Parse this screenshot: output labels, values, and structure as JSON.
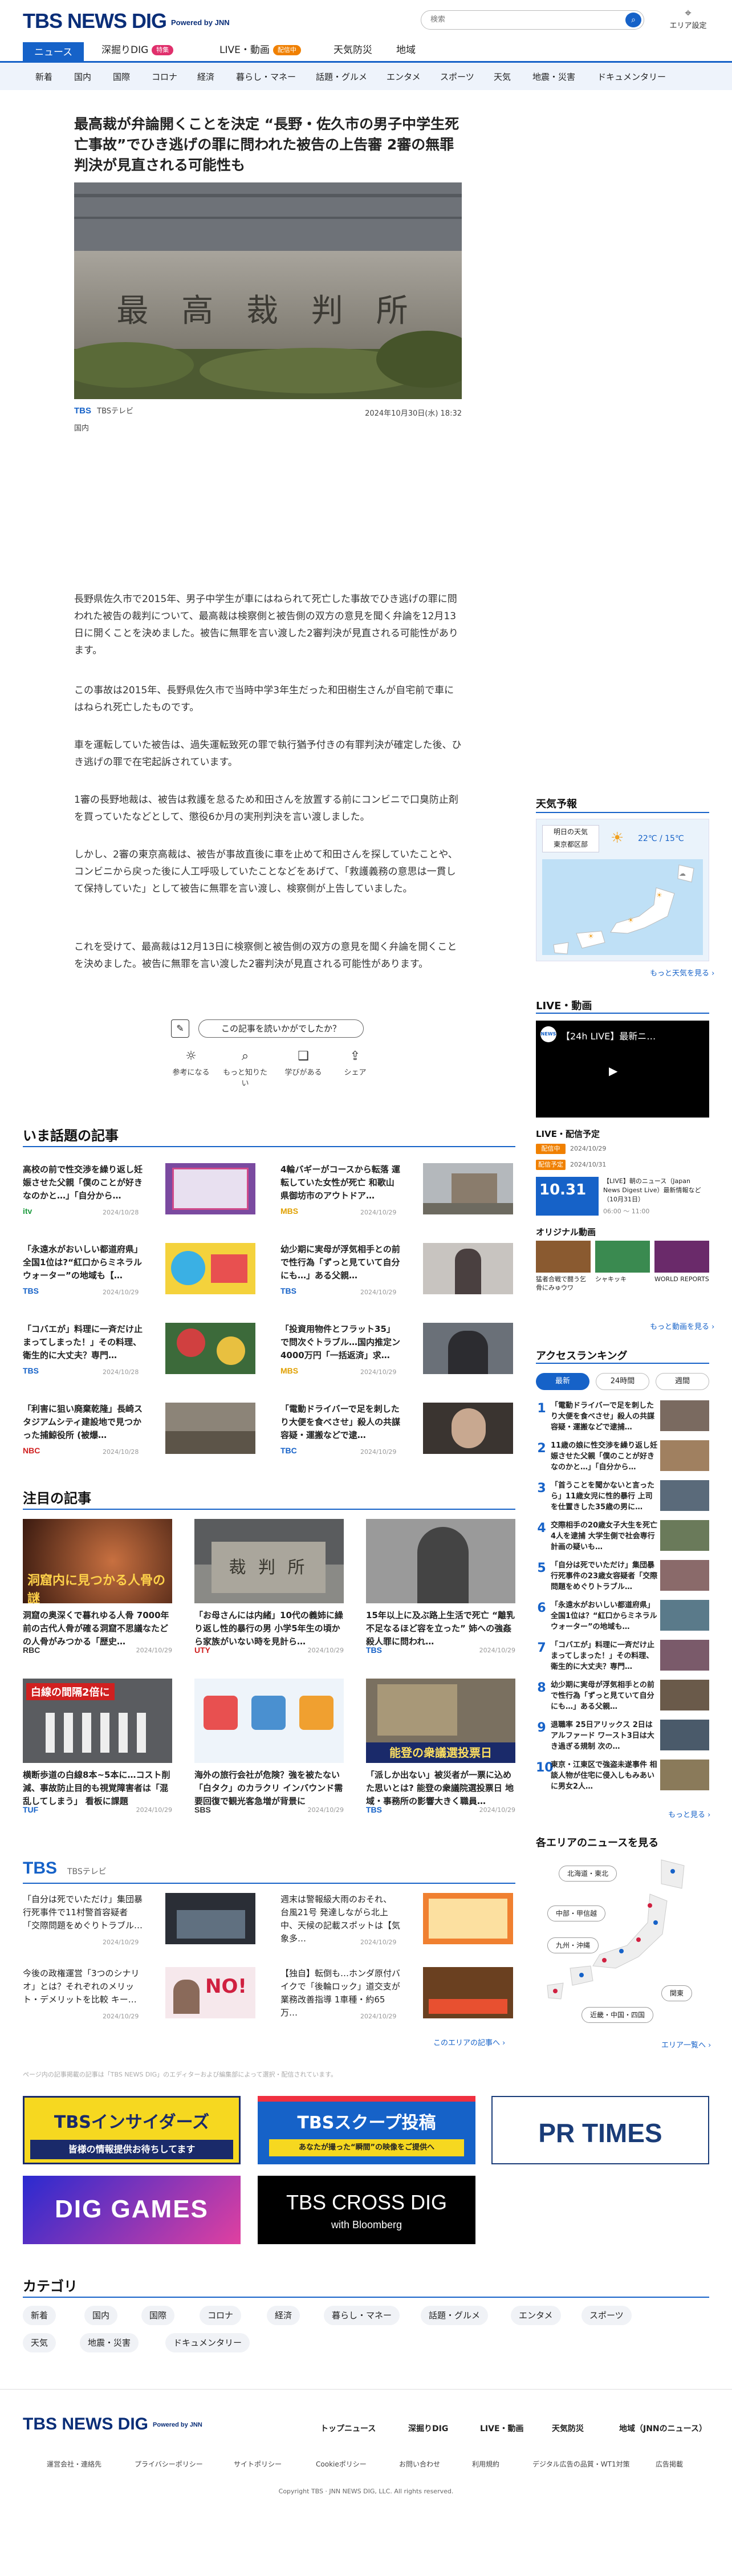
{
  "header": {
    "logo": "TBS NEWS DIG",
    "powered": "Powered by JNN",
    "search_placeholder": "検索",
    "area_label": "エリア設定"
  },
  "nav_main": [
    {
      "label": "ニュース",
      "active": true
    },
    {
      "label": "深掘りDIG",
      "badge": "特集"
    },
    {
      "label": "LIVE・動画",
      "badge": "配信中"
    },
    {
      "label": "天気防災"
    },
    {
      "label": "地域"
    }
  ],
  "nav_sub": [
    "新着",
    "国内",
    "国際",
    "コロナ",
    "経済",
    "暮らし・マネー",
    "話題・グルメ",
    "エンタメ",
    "スポーツ",
    "天気",
    "地震・災害",
    "ドキュメンタリー"
  ],
  "article": {
    "title": "最高裁が弁論開くことを決定 “長野・佐久市の男子中学生死亡事故”でひき逃げの罪に問われた被告の上告審 2審の無罪判決が見直される可能性も",
    "image_text": "最 高 裁 判 所",
    "source": "TBS",
    "source_name": "TBSテレビ",
    "date": "2024年10月30日(水) 18:32",
    "category": "国内",
    "paragraphs": [
      "長野県佐久市で2015年、男子中学生が車にはねられて死亡した事故でひき逃げの罪に問われた被告の裁判について、最高裁は検察側と被告側の双方の意見を聞く弁論を12月13日に開くことを決めました。被告に無罪を言い渡した2審判決が見直される可能性があります。",
      "この事故は2015年、長野県佐久市で当時中学3年生だった和田樹生さんが自宅前で車にはねられ死亡したものです。",
      "車を運転していた被告は、過失運転致死の罪で執行猶予付きの有罪判決が確定した後、ひき逃げの罪で在宅起訴されています。",
      "1審の長野地裁は、被告は救護を怠るため和田さんを放置する前にコンビニで口臭防止剤を買っていたなどとして、懲役6か月の実刑判決を言い渡しました。",
      "しかし、2審の東京高裁は、被告が事故直後に車を止めて和田さんを探していたことや、コンビニから戻った後に人工呼吸していたことなどをあげて、「救護義務の意思は一貫して保持していた」として被告に無罪を言い渡し、検察側が上告していました。",
      "これを受けて、最高裁は12月13日に検察側と被告側の双方の意見を聞く弁論を開くことを決めました。被告に無罪を言い渡した2審判決が見直される可能性があります。"
    ],
    "survey_question": "この記事を読いかがでしたか？",
    "reactions": [
      "参考になる",
      "もっと知りたい",
      "学びがある",
      "シェア"
    ]
  },
  "trending": {
    "heading": "いま話題の記事",
    "items": [
      {
        "title": "高校の前で性交渉を繰り返し妊娠させた父親「僕のことが好きなのかと…」「自分から…",
        "source": "itv",
        "source_color": "#1a9a3c",
        "date": "2024/10/28"
      },
      {
        "title": "4輪バギーがコースから転落 運転していた女性が死亡 和歌山県御坊市のアウトドア…",
        "source": "MBS",
        "source_color": "#e0a000",
        "date": "2024/10/29"
      },
      {
        "title": "「永遠水がおいしい都道府県」全国1位は?“紅口からミネラルウォーター”の地域も【…",
        "source": "TBS",
        "source_color": "#1662c8",
        "date": "2024/10/29"
      },
      {
        "title": "幼少期に実母が浮気相手との前で性行為「ずっと見ていて自分にも…」ある父親…",
        "source": "TBS",
        "source_color": "#1662c8",
        "date": "2024/10/29"
      },
      {
        "title": "「コバエが」料理に一斉だけ止まってしまった！」その料理、衛生的に大丈夫？専門…",
        "source": "TBS",
        "source_color": "#1662c8",
        "date": "2024/10/28"
      },
      {
        "title": "「投資用物件とフラット35」で問次ぐトラブル…国内推定ン4000万円「一括返済」求…",
        "source": "MBS",
        "source_color": "#e0a000",
        "date": "2024/10/29"
      },
      {
        "title": "「利害に狙い廃棄乾隆」長崎スタジアムシティ建設地で見つかった捕鯨役所 (被爆…",
        "source": "NBC",
        "source_color": "#d02020",
        "date": "2024/10/28"
      },
      {
        "title": "「電動ドライバーで足を刺したり大便を食べさせ」殺人の共謀容疑・運搬などで逮…",
        "source": "TBC",
        "source_color": "#1662c8",
        "date": "2024/10/29"
      }
    ]
  },
  "featured": {
    "heading": "注目の記事",
    "items": [
      {
        "title": "洞窟の奥深くで暮れゆる人骨 7000年前の古代人骨が確る洞窟不思議なたどの人骨がみつかる「歴史…",
        "source": "RBC",
        "source_color": "#333333",
        "date": "2024/10/29",
        "overlay": "洞窟内に見つかる人骨の謎"
      },
      {
        "title": "「お母さんには内緒」10代の義姉に繰り返し性的暴行の男 小学5年生の頃から家族がいない時を見計ら…",
        "source": "UTY",
        "source_color": "#d02020",
        "date": "2024/10/29",
        "overlay": "裁 判 所"
      },
      {
        "title": "15年以上に及ぶ路上生活で死亡 “離乳不足なるほど容を立った” 姉への強姦殺人罪に問われ…",
        "source": "TBS",
        "source_color": "#1662c8",
        "date": "2024/10/29",
        "overlay": ""
      },
      {
        "title": "横断歩道の白線8本~5本に…コスト削減、事故防止目的も視覚障害者は「混乱してしまう」 看板に課題",
        "source": "TUF",
        "source_color": "#1662c8",
        "date": "2024/10/29",
        "overlay": "白線の間隔2倍に"
      },
      {
        "title": "海外の旅行会社が危険？強を被たない「白タク」のカラクリ インバウンド需要回復で観光客急増が背景に",
        "source": "SBS",
        "source_color": "#333333",
        "date": "2024/10/29",
        "overlay": ""
      },
      {
        "title": "「派しか出ない」被災者が一票に込めた思いとは? 能登の衆議院選投票日 地域・事務所の影響大きく職員…",
        "source": "TBS",
        "source_color": "#1662c8",
        "date": "2024/10/29",
        "overlay": "能登の衆議選投票日"
      }
    ]
  },
  "tbs_block": {
    "heading": "TBS",
    "subheading": "TBSテレビ",
    "items": [
      {
        "title": "「自分は死でいただけ」集団暴行死事件で11村警首容疑者「交際問題をめぐりトラブル…",
        "date": "2024/10/29"
      },
      {
        "title": "週末は警報級大雨のおそれ、台風21号 発達しながら北上中、天候の記載スポットは【気象多…",
        "date": "2024/10/29"
      },
      {
        "title": "今後の政権運営「3つのシナリオ」とは？それぞれのメリット・デメリットを比較 キー…",
        "date": "2024/10/29"
      },
      {
        "title": "【独自】転倒も…ホンダ原付バイクで「後輪ロック」道交支が業務改善指導 1車種・約65万…",
        "date": "2024/10/29"
      }
    ],
    "more": "このエリアの記事へ ›",
    "disclaimer": "ページ内の記事掲載の記事は「TBS NEWS DIG」のエディターおよび編集部によって選択・配信されています。"
  },
  "banners": {
    "insiders": "TBSインサイダーズ",
    "insiders_sub": "皆様の情報提供お待ちしてます",
    "scoop": "TBSスクープ投稿",
    "scoop_sub": "あなたが撮った“瞬間”の映像をご提供へ",
    "prtimes": "PR TIMES",
    "diggames": "DIG GAMES",
    "crossdig": "TBS CROSS DIG",
    "crossdig_sub": "with Bloomberg"
  },
  "categories": {
    "heading": "カテゴリ",
    "items": [
      "新着",
      "国内",
      "国際",
      "コロナ",
      "経済",
      "暮らし・マネー",
      "話題・グルメ",
      "エンタメ",
      "スポーツ",
      "天気",
      "地震・災害",
      "ドキュメンタリー"
    ]
  },
  "sidebar": {
    "weather_heading": "天気予報",
    "weather_date": "明日の天気",
    "weather_place": "東京都区部",
    "weather_temp": "22℃ / 15℃",
    "weather_more": "もっと天気を見る ›",
    "live_heading": "LIVE・動画",
    "live_title": "【24h LIVE】最新ニ…",
    "schedule_heading": "LIVE・配信予定",
    "schedule_items": [
      {
        "tag": "配信中",
        "date": "2024/10/29"
      },
      {
        "tag": "配信予定",
        "date": "2024/10/31"
      }
    ],
    "schedule_event_date": "10.31",
    "schedule_event_title": "【LIVE】朝のニュース（Japan News Digest Live）最新情報など（10月31日）",
    "schedule_event_time": "06:00 ～ 11:00",
    "original_heading": "オリジナル動画",
    "original_items": [
      "猛者合戦で闘う乞骨にみゅウワ",
      "シャキッキ",
      "WORLD REPORTS"
    ],
    "original_more": "もっと動画を見る ›",
    "ranking_heading": "アクセスランキング",
    "ranking_tabs": [
      "最新",
      "24時間",
      "週間"
    ],
    "ranking": [
      "「電動ドライバーで足を刺したり大便を食べさせ」殺人の共謀容疑・運搬などで逮捕…",
      "11歳の娘に性交渉を繰り返し妊娠させた父親「僕のことが好きなのかと…」「自分から…",
      "「首うことを聞かないと言ったら」11歳女児に性的暴行 上司を仕置きした35歳の男に…",
      "交際相手の20歳女子大生を死亡 4人を逮捕 大学生側で社会専行計画の疑いも…",
      "「自分は死でいただけ」集団暴行死事件の23歳女容疑者「交際問題をめぐりトラブル…",
      "「永遠水がおいしい都道府県」全国1位は？“紅口からミネラルウォーター”の地域も…",
      "「コバエが」料理に一斉だけ止まってしまった！」その料理、衛生的に大丈夫？専門…",
      "幼少期に実母が浮気相手との前で性行為「ずっと見ていて自分にも…」ある父親…",
      "退職率 25日アリックス 2日はアルファード ワースト3日は大き過ぎる規制 次の…",
      "東京・江東区で強盗未遂事件 相談人物が住宅に侵入しもみあいに男女2人…"
    ],
    "ranking_more": "もっと見る ›",
    "area_heading": "各エリアのニュースを見る",
    "area_regions": [
      "北海道・東北",
      "中部・甲信越",
      "九州・沖縄",
      "関東",
      "近畿・中国・四国"
    ],
    "area_more": "エリア一覧へ ›"
  },
  "footer": {
    "logo": "TBS NEWS DIG",
    "powered": "Powered by JNN",
    "links_main": [
      "トップニュース",
      "深掘りDIG",
      "LIVE・動画",
      "天気防災",
      "地域（JNNのニュース）"
    ],
    "links_sub": [
      "運営会社・連絡先",
      "プライバシーポリシー",
      "サイトポリシー",
      "Cookieポリシー",
      "お問い合わせ",
      "利用規約",
      "デジタル広告の品質・WT1対策",
      "広告掲載"
    ],
    "copyright": "Copyright TBS · JNN NEWS DIG, LLC. All rights reserved."
  }
}
